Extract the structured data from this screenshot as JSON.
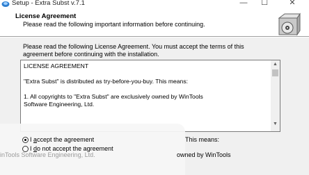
{
  "window": {
    "title": "Setup - Extra Subst v.7.1",
    "minimize_glyph": "—",
    "maximize_glyph": "☐",
    "close_glyph": "✕"
  },
  "header": {
    "title": "License Agreement",
    "subtitle": "Please read the following important information before continuing."
  },
  "instructions": {
    "line1": "Please read the following License Agreement. You must accept the terms of this",
    "line2": "agreement before continuing with the installation."
  },
  "license": {
    "heading": "LICENSE AGREEMENT",
    "para1": "\"Extra Subst\" is distributed as try-before-you-buy. This means:",
    "para2_line1": "1. All copyrights to \"Extra Subst\" are exclusively owned by WinTools",
    "para2_line2": "Software Engineering, Ltd."
  },
  "radios": {
    "accept_prefix": "I ",
    "accept_underlined": "a",
    "accept_suffix": "ccept the agreement",
    "accept_checked": true,
    "decline_prefix": "I ",
    "decline_underlined": "d",
    "decline_suffix": "o not accept the agreement",
    "decline_checked": false
  },
  "background_fragments": {
    "means": "This means:",
    "owned": "owned by WinTools",
    "software": "inTools Software Engineering, Ltd."
  },
  "icons": {
    "app": "setup-icon",
    "header": "disk-box-icon"
  }
}
